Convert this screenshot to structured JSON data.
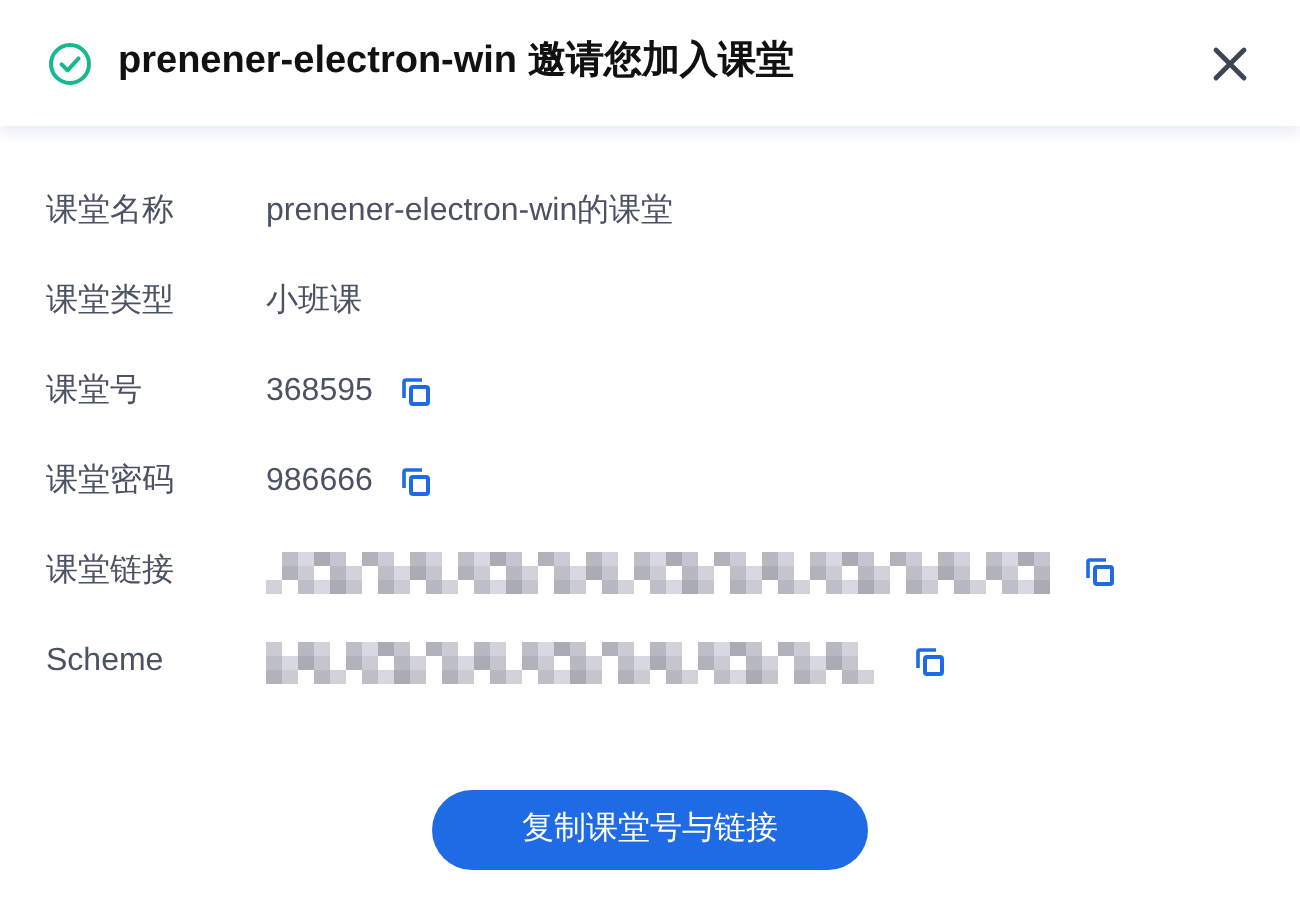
{
  "dialog": {
    "title": "prenener-electron-win 邀请您加入课堂"
  },
  "rows": [
    {
      "label": "课堂名称",
      "kind": "text",
      "value": "prenener-electron-win的课堂"
    },
    {
      "label": "课堂类型",
      "kind": "text",
      "value": "小班课"
    },
    {
      "label": "课堂号",
      "kind": "copy",
      "value": "368595"
    },
    {
      "label": "课堂密码",
      "kind": "copy",
      "value": "986666"
    },
    {
      "label": "课堂链接",
      "kind": "redacted"
    },
    {
      "label": "Scheme",
      "kind": "redacted"
    }
  ],
  "button": "复制课堂号与链接"
}
